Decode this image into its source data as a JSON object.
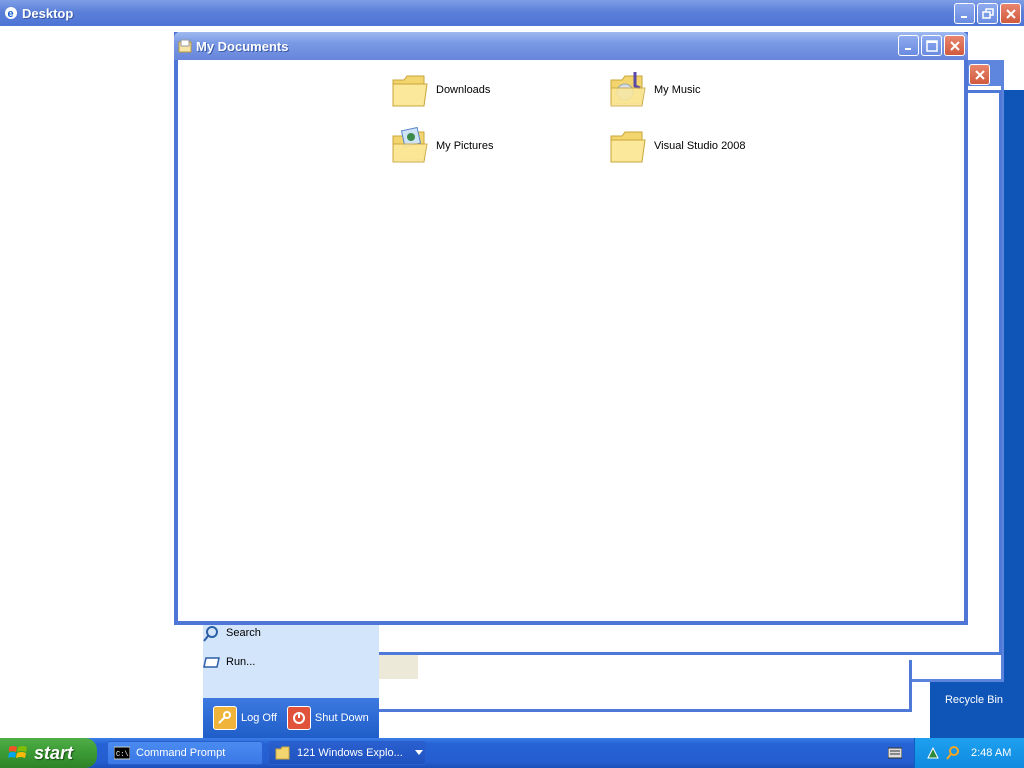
{
  "desktop_window": {
    "title": "Desktop"
  },
  "mydocs_window": {
    "title": "My Documents",
    "items": [
      {
        "label": "Downloads",
        "icon": "folder-icon"
      },
      {
        "label": "My Music",
        "icon": "music-folder-icon"
      },
      {
        "label": "My Pictures",
        "icon": "pictures-folder-icon"
      },
      {
        "label": "Visual Studio 2008",
        "icon": "folder-icon"
      }
    ]
  },
  "start_menu": {
    "search_label": "Search",
    "run_label": "Run...",
    "logoff_label": "Log Off",
    "shutdown_label": "Shut Down"
  },
  "desktop_icons": {
    "recycle_bin_label": "Recycle Bin"
  },
  "taskbar": {
    "start_label": "start",
    "tasks": [
      {
        "label": "Command Prompt",
        "icon": "cmd-icon"
      },
      {
        "label": "121 Windows Explo...",
        "icon": "folder-icon"
      }
    ],
    "clock": "2:48 AM"
  },
  "colors": {
    "titlebar_blue": "#5b80da",
    "taskbar_blue": "#245dd0",
    "start_green": "#3c9a35",
    "tray_blue": "#0f8ae0"
  }
}
